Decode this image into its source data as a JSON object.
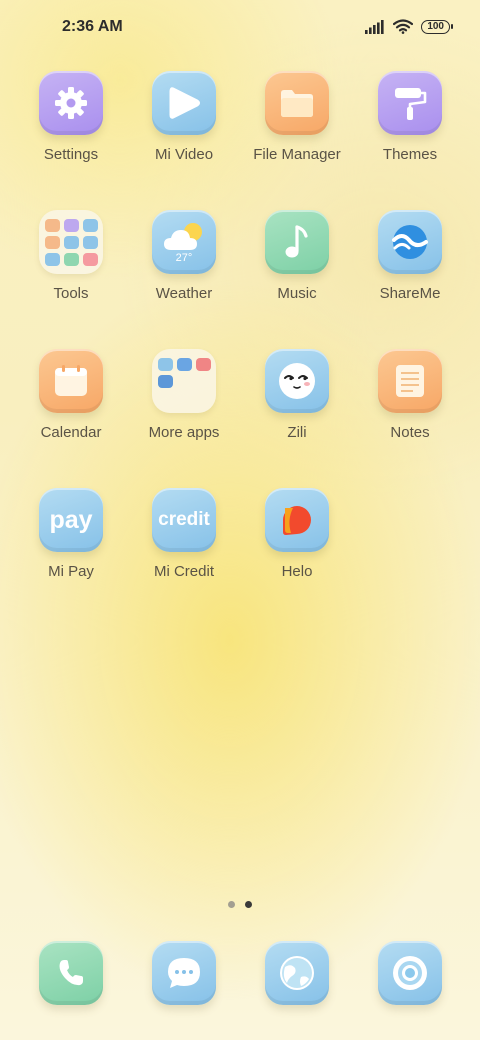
{
  "status_bar": {
    "time": "2:36 AM",
    "battery": "100",
    "signal_icon": "signal-bars-icon",
    "wifi_icon": "wifi-icon"
  },
  "apps": [
    {
      "label": "Settings",
      "icon": "gear-icon"
    },
    {
      "label": "Mi Video",
      "icon": "play-icon"
    },
    {
      "label": "File Manager",
      "icon": "folder-icon"
    },
    {
      "label": "Themes",
      "icon": "paint-roller-icon"
    },
    {
      "label": "Tools",
      "icon": "tools-folder-icon"
    },
    {
      "label": "Weather",
      "icon": "weather-icon",
      "temperature": "27°"
    },
    {
      "label": "Music",
      "icon": "music-note-icon"
    },
    {
      "label": "ShareMe",
      "icon": "shareme-icon"
    },
    {
      "label": "Calendar",
      "icon": "calendar-icon"
    },
    {
      "label": "More apps",
      "icon": "more-apps-folder-icon"
    },
    {
      "label": "Zili",
      "icon": "zili-face-icon"
    },
    {
      "label": "Notes",
      "icon": "notes-icon"
    },
    {
      "label": "Mi Pay",
      "icon": "mi-pay-icon",
      "icon_text": "pay"
    },
    {
      "label": "Mi Credit",
      "icon": "mi-credit-icon",
      "icon_text": "credit"
    },
    {
      "label": "Helo",
      "icon": "helo-icon"
    }
  ],
  "dock": [
    {
      "icon": "phone-icon"
    },
    {
      "icon": "messages-icon"
    },
    {
      "icon": "browser-icon"
    },
    {
      "icon": "camera-icon"
    }
  ],
  "pager": {
    "pages": 2,
    "current": 2
  },
  "colors": {
    "label_text": "#5a5346",
    "status_text": "#2c2c2c",
    "wallpaper_yellow": "#f8e57e"
  }
}
